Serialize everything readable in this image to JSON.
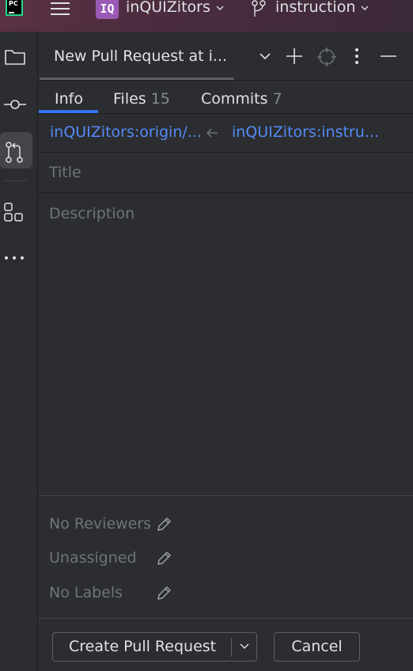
{
  "titlebar": {
    "app_logo": "PC",
    "menu_icon": "hamburger-icon",
    "project_badge": "IQ",
    "project_name": "inQUIZitors",
    "branch_icon": "git-branch-icon",
    "branch_name": "instruction"
  },
  "toolstrip": {
    "items": [
      {
        "name": "project-icon",
        "active": false
      },
      {
        "name": "commit-icon",
        "active": false
      },
      {
        "name": "pull-requests-icon",
        "active": true
      },
      {
        "name": "structure-icon",
        "active": false
      },
      {
        "name": "more-icon",
        "active": false
      }
    ]
  },
  "panel": {
    "title": "New Pull Request at i...",
    "toolbar_icons": [
      "chevron-down-icon",
      "plus-icon",
      "locate-icon",
      "more-vertical-icon",
      "minimize-icon"
    ],
    "tabs": [
      {
        "label": "Info",
        "count": "",
        "active": true
      },
      {
        "label": "Files",
        "count": "15",
        "active": false
      },
      {
        "label": "Commits",
        "count": "7",
        "active": false
      }
    ],
    "base_branch": "inQUIZitors:origin/...",
    "head_branch": "inQUIZitors:instru...",
    "title_placeholder": "Title",
    "description_placeholder": "Description",
    "reviewers": "No Reviewers",
    "assignees": "Unassigned",
    "labels": "No Labels",
    "create_button": "Create Pull Request",
    "cancel_button": "Cancel"
  },
  "colors": {
    "accent": "#3574f0",
    "link": "#548af7",
    "project_badge": "#9b59b6",
    "background": "#2b2d30"
  }
}
